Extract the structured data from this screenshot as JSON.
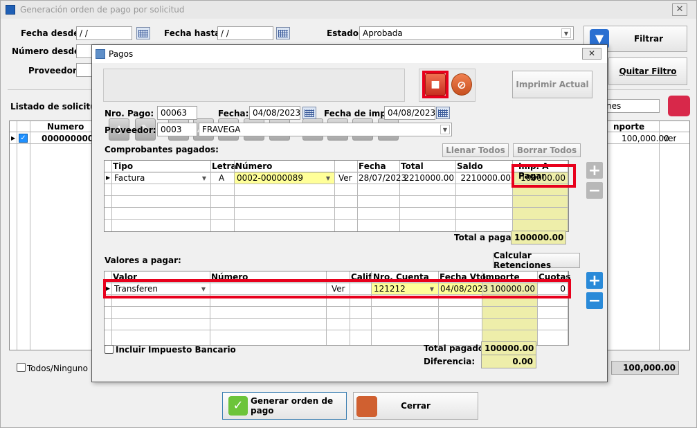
{
  "main": {
    "title": "Generación orden de pago por solicitud",
    "fecha_desde_label": "Fecha desde:",
    "fecha_desde_value": " / /",
    "fecha_hasta_label": "Fecha hasta:",
    "fecha_hasta_value": " / /",
    "estado_label": "Estado:",
    "estado_value": "Aprobada",
    "numero_desde_label": "Número desde:",
    "proveedor_label": "Proveedor:",
    "filtrar_label": "Filtrar",
    "quitar_filtro_label": "Quitar Filtro",
    "listado_label": "Listado de solicitud o",
    "nes_partial": "nes",
    "col_numero": "Numero",
    "col_importe": "nporte",
    "row_numero": "0000000001",
    "row_importe": "100,000.00",
    "row_ver": "ver",
    "todos_label": "Todos/Ninguno",
    "total_value": "100,000.00",
    "generar_label": "Generar orden de pago",
    "cerrar_label": "Cerrar"
  },
  "dialog": {
    "title": "Pagos",
    "imprimir_actual": "Imprimir Actual",
    "nro_pago_label": "Nro. Pago:",
    "nro_pago_value": "00063",
    "fecha_label": "Fecha:",
    "fecha_value": "04/08/2023",
    "fecha_imp_label": "Fecha de imp.:",
    "fecha_imp_value": "04/08/2023",
    "proveedor_label": "Proveedor:",
    "proveedor_code": "0003",
    "proveedor_name": "FRAVEGA",
    "comprobantes_label": "Comprobantes pagados:",
    "llenar_todos": "Llenar Todos",
    "borrar_todos": "Borrar Todos",
    "comp_headers": [
      "Tipo",
      "Letra",
      "Número",
      "Fecha",
      "Total",
      "Saldo",
      "Imp. A Pagar"
    ],
    "comp_row": {
      "tipo": "Factura",
      "letra": "A",
      "numero": "0002-00000089",
      "ver": "Ver",
      "fecha": "28/07/2023",
      "total": "2210000.00",
      "saldo": "2210000.00",
      "imp_a_pagar": "100000.00"
    },
    "total_a_pagar_label": "Total a pagar:",
    "total_a_pagar_value": "100000.00",
    "valores_label": "Valores a pagar:",
    "calcular_retenciones": "Calcular Retenciones",
    "val_headers": [
      "Valor",
      "Número",
      "Calif",
      "Nro. Cuenta",
      "Fecha Vto.",
      "Importe",
      "Cuotas"
    ],
    "val_row": {
      "valor": "Transferen",
      "ver": "Ver",
      "cuenta": "121212",
      "fecha_vto": "04/08/2023",
      "importe": "100000.00",
      "cuotas": "0"
    },
    "incluir_label": "Incluir Impuesto Bancario",
    "total_pagado_label": "Total pagado:",
    "total_pagado_value": "100000.00",
    "diferencia_label": "Diferencia:",
    "diferencia_value": "0.00"
  },
  "icons": [
    "app-icon",
    "close-icon",
    "calendar-icon",
    "funnel-icon",
    "printer-icon",
    "add-icon",
    "edit-icon",
    "search-icon",
    "sort-az-icon",
    "filter-icon",
    "clipboard-icon",
    "first-icon",
    "prev-icon",
    "next-icon",
    "last-icon",
    "save-icon",
    "cancel-icon",
    "plus-icon",
    "minus-icon",
    "check-icon"
  ],
  "colors": {
    "highlight_red": "#e8001c",
    "yellow_cell": "#ffff99",
    "selection_blue": "#1e90ff"
  }
}
